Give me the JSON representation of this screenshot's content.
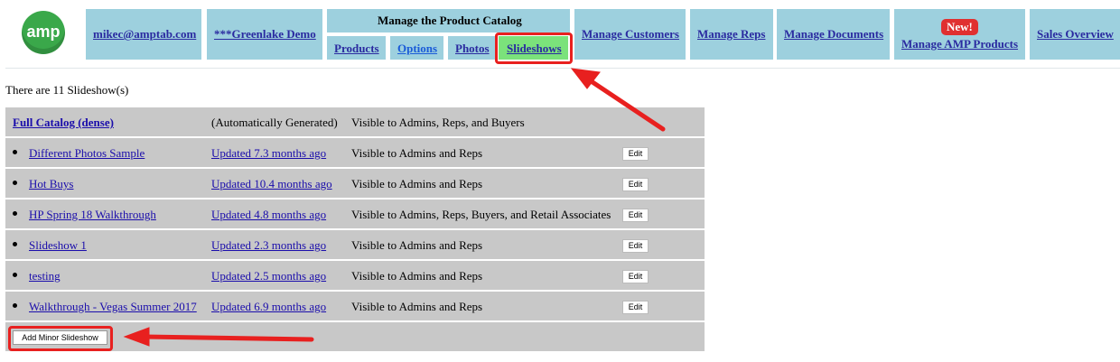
{
  "logo": {
    "text": "amp"
  },
  "nav": {
    "user": "mikec@amptab.com",
    "account": "***Greenlake Demo",
    "catalog_title": "Manage the Product Catalog",
    "subtabs": [
      "Products",
      "Options",
      "Photos",
      "Slideshows"
    ],
    "active_subtab": "Slideshows",
    "customers": "Manage Customers",
    "reps": "Manage Reps",
    "documents": "Manage Documents",
    "amp_products": "Manage AMP Products",
    "new_badge": "New!",
    "sales": "Sales Overview"
  },
  "summary": "There are 11 Slideshow(s)",
  "full_catalog": {
    "name": "Full Catalog (dense)",
    "generated": "(Automatically Generated)",
    "visibility": "Visible to Admins, Reps, and Buyers"
  },
  "slideshows": [
    {
      "name": "Different Photos Sample",
      "updated": "Updated 7.3 months ago",
      "visibility": "Visible to Admins and Reps",
      "edit": "Edit"
    },
    {
      "name": "Hot Buys",
      "updated": "Updated 10.4 months ago",
      "visibility": "Visible to Admins and Reps",
      "edit": "Edit"
    },
    {
      "name": "HP Spring 18 Walkthrough",
      "updated": "Updated 4.8 months ago",
      "visibility": "Visible to Admins, Reps, Buyers, and Retail Associates",
      "edit": "Edit"
    },
    {
      "name": "Slideshow 1",
      "updated": "Updated 2.3 months ago",
      "visibility": "Visible to Admins and Reps",
      "edit": "Edit"
    },
    {
      "name": "testing",
      "updated": "Updated 2.5 months ago",
      "visibility": "Visible to Admins and Reps",
      "edit": "Edit"
    },
    {
      "name": "Walkthrough - Vegas Summer 2017",
      "updated": "Updated 6.9 months ago",
      "visibility": "Visible to Admins and Reps",
      "edit": "Edit"
    }
  ],
  "add_button": "Add Minor Slideshow",
  "colors": {
    "nav_bg": "#9dd0de",
    "active_tab": "#7be27b",
    "highlight": "#e8201f",
    "row_bg": "#c8c8c8"
  }
}
